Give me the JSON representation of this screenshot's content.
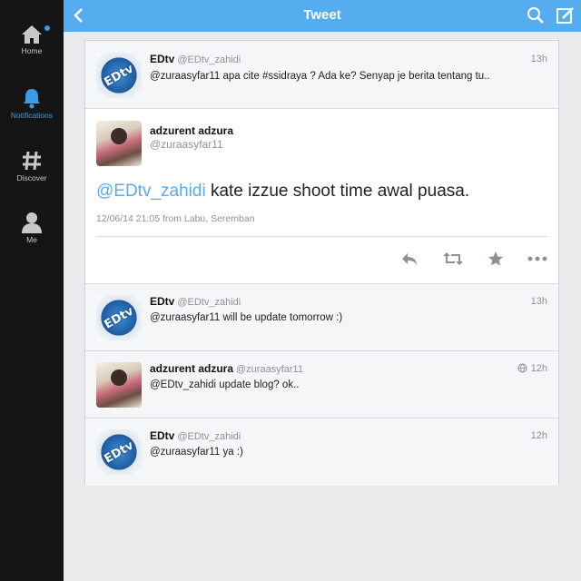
{
  "nav": [
    {
      "label": "Home",
      "icon": "home-icon"
    },
    {
      "label": "Notifications",
      "icon": "bell-icon"
    },
    {
      "label": "Discover",
      "icon": "hashtag-icon"
    },
    {
      "label": "Me",
      "icon": "person-icon"
    }
  ],
  "header": {
    "title": "Tweet"
  },
  "colors": {
    "accent": "#55acee",
    "sidebar": "#151515"
  },
  "tweets": [
    {
      "name": "EDtv",
      "handle": "@EDtv_zahidi",
      "time": "13h",
      "text": "@zuraasyfar11 apa cite #ssidraya ? Ada ke? Senyap je berita tentang tu.."
    },
    {
      "name": "adzurent adzura",
      "handle": "@zuraasyfar11",
      "mention": "@EDtv_zahidi",
      "text": " kate izzue shoot time awal puasa.",
      "meta": "12/06/14 21:05 from Labu, Seremban"
    },
    {
      "name": "EDtv",
      "handle": "@EDtv_zahidi",
      "time": "13h",
      "text": "@zuraasyfar11 will be update tomorrow :)"
    },
    {
      "name": "adzurent adzura",
      "handle": "@zuraasyfar11",
      "time": "12h",
      "text": "@EDtv_zahidi update blog? ok.."
    },
    {
      "name": "EDtv",
      "handle": "@EDtv_zahidi",
      "time": "12h",
      "text": "@zuraasyfar11 ya :)"
    }
  ],
  "avatar_text": "EDtv"
}
